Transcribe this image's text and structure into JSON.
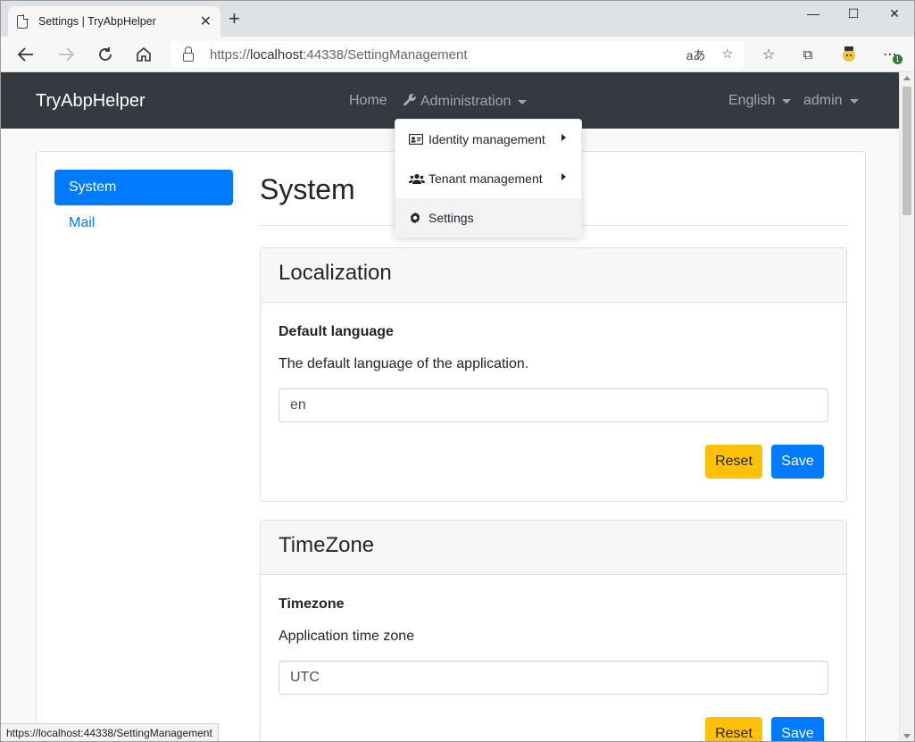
{
  "browser": {
    "tab_title": "Settings | TryAbpHelper",
    "tab_close": "✕",
    "new_tab": "+",
    "minimize": "—",
    "maximize": "☐",
    "close": "✕",
    "url_prefix": "https://",
    "url_host": "localhost",
    "url_rest": ":44338/SettingManagement",
    "status_url": "https://localhost:44338/SettingManagement",
    "translate_icon": "aあ",
    "profile_badge": "1"
  },
  "navbar": {
    "brand": "TryAbpHelper",
    "home": "Home",
    "administration": "Administration",
    "language": "English",
    "user": "admin"
  },
  "dropdown": {
    "items": [
      {
        "label": "Identity management",
        "icon": "id-card-icon",
        "has_submenu": true
      },
      {
        "label": "Tenant management",
        "icon": "users-icon",
        "has_submenu": true
      },
      {
        "label": "Settings",
        "icon": "gear-icon",
        "has_submenu": false
      }
    ]
  },
  "sidebar": {
    "items": [
      {
        "label": "System",
        "active": true
      },
      {
        "label": "Mail",
        "active": false
      }
    ]
  },
  "main": {
    "title": "System",
    "groups": [
      {
        "header": "Localization",
        "field_label": "Default language",
        "field_desc": "The default language of the application.",
        "value": "en",
        "reset_label": "Reset",
        "save_label": "Save"
      },
      {
        "header": "TimeZone",
        "field_label": "Timezone",
        "field_desc": "Application time zone",
        "value": "UTC",
        "reset_label": "Reset",
        "save_label": "Save"
      }
    ]
  },
  "colors": {
    "navbar": "#343a40",
    "primary": "#007bff",
    "warning": "#ffc107"
  }
}
